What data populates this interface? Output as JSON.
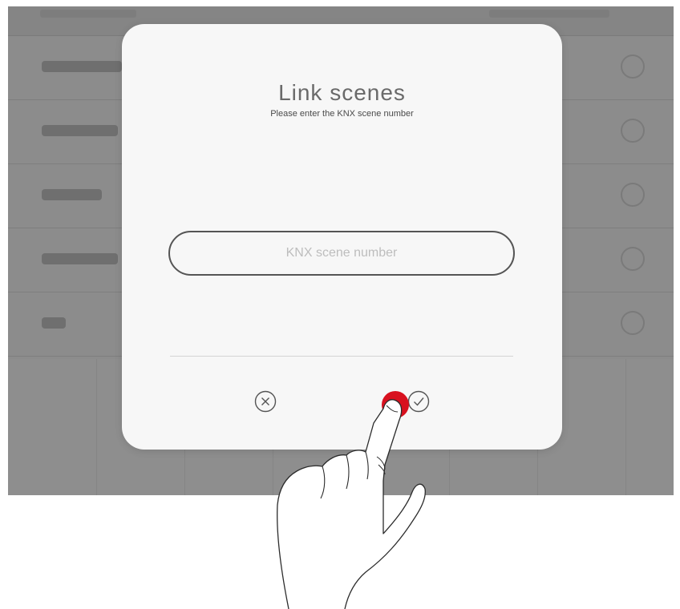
{
  "dialog": {
    "title": "Link scenes",
    "subtitle": "Please enter the KNX scene number",
    "input": {
      "placeholder": "KNX scene number",
      "value": ""
    },
    "cancel_icon": "circle-x-icon",
    "confirm_icon": "circle-check-icon"
  },
  "colors": {
    "overlay": "#8c8c8c",
    "dialog_background": "#f7f7f7",
    "touch_indicator": "#d8111f"
  }
}
